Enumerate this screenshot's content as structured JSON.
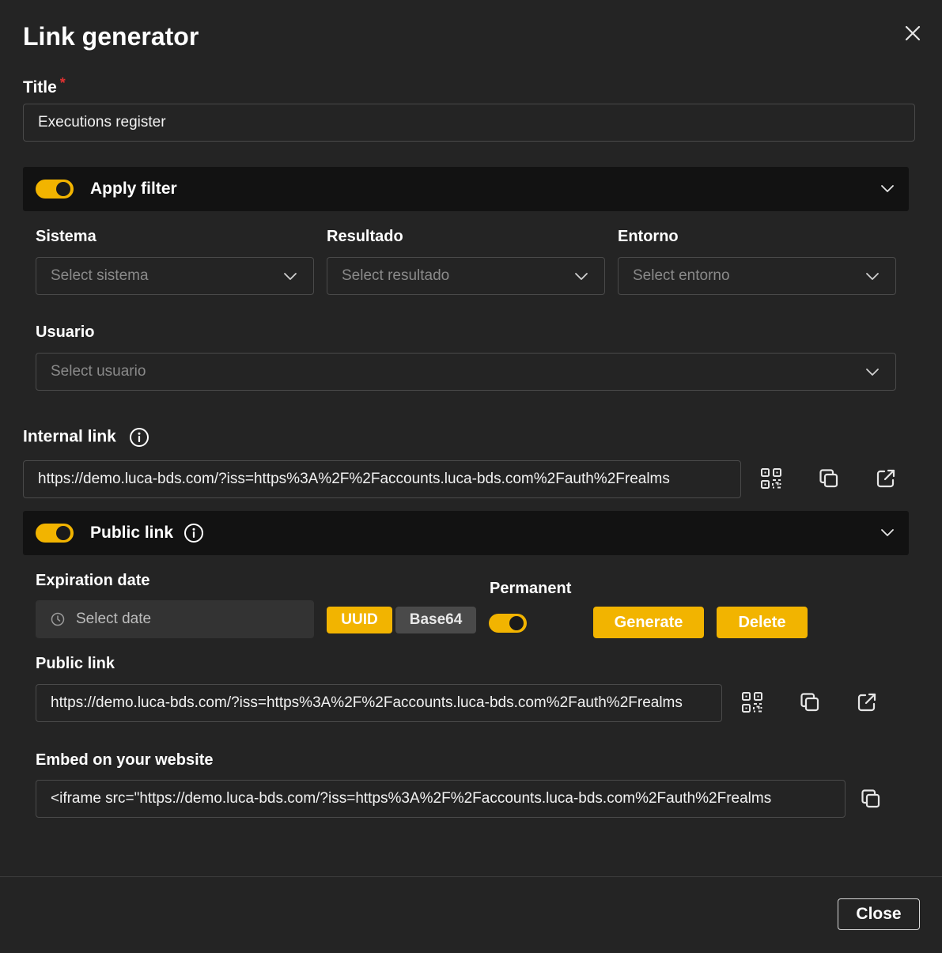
{
  "dialog": {
    "title": "Link generator",
    "close_label": "Close"
  },
  "title_field": {
    "label": "Title",
    "required_mark": "*",
    "value": "Executions register"
  },
  "apply_filter": {
    "label": "Apply filter",
    "enabled": true,
    "filters": [
      {
        "label": "Sistema",
        "placeholder": "Select sistema"
      },
      {
        "label": "Resultado",
        "placeholder": "Select resultado"
      },
      {
        "label": "Entorno",
        "placeholder": "Select entorno"
      },
      {
        "label": "Usuario",
        "placeholder": "Select usuario"
      }
    ]
  },
  "internal_link": {
    "label": "Internal link",
    "value": "https://demo.luca-bds.com/?iss=https%3A%2F%2Faccounts.luca-bds.com%2Fauth%2Frealms"
  },
  "public_link_section": {
    "label": "Public link",
    "enabled": true,
    "expiration_label": "Expiration date",
    "date_placeholder": "Select date",
    "chips": {
      "uuid": "UUID",
      "base64": "Base64"
    },
    "permanent_label": "Permanent",
    "permanent": true,
    "generate_label": "Generate",
    "delete_label": "Delete",
    "public_link_label": "Public link",
    "public_link_value": "https://demo.luca-bds.com/?iss=https%3A%2F%2Faccounts.luca-bds.com%2Fauth%2Frealms",
    "embed_label": "Embed on your website",
    "embed_value": "<iframe src=\"https://demo.luca-bds.com/?iss=https%3A%2F%2Faccounts.luca-bds.com%2Fauth%2Frealms"
  },
  "colors": {
    "accent": "#f2b400",
    "background": "#242424",
    "bar": "#121212",
    "muted": "#8a8a8a"
  },
  "icons": [
    "close-icon",
    "chevron-down-icon",
    "info-icon",
    "qr-code-icon",
    "copy-icon",
    "external-link-icon",
    "clock-icon"
  ]
}
